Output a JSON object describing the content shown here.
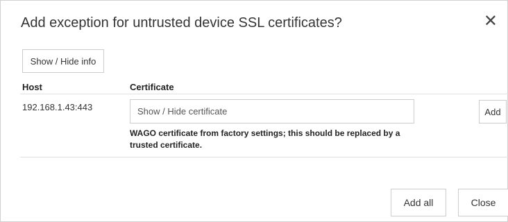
{
  "dialog": {
    "title": "Add exception for untrusted device SSL certificates?",
    "close_glyph": "✕",
    "close_icon": "close-icon"
  },
  "toolbar": {
    "toggle_info_label": "Show / Hide info"
  },
  "table": {
    "headers": {
      "host": "Host",
      "certificate": "Certificate"
    },
    "rows": [
      {
        "host": "192.168.1.43:443",
        "certificate_toggle": "Show / Hide certificate",
        "note": "WAGO certificate from factory settings; this should be replaced by a trusted certificate.",
        "add_label": "Add"
      }
    ]
  },
  "footer": {
    "add_all_label": "Add all",
    "close_label": "Close"
  }
}
